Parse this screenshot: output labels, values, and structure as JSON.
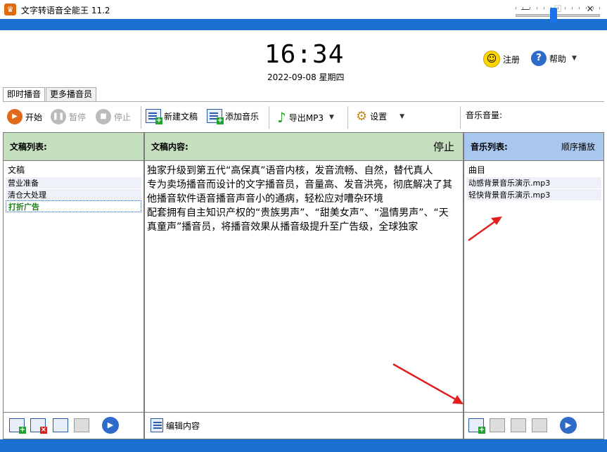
{
  "window": {
    "app_icon": "crown-icon",
    "title": "文字转语音全能王 11.2",
    "minimize": "—",
    "maximize": "☐",
    "close": "✕"
  },
  "header": {
    "clock": "16:34",
    "date": "2022-09-08 星期四",
    "register_label": "注册",
    "help_label": "帮助"
  },
  "tabs": [
    {
      "label": "即时播音"
    },
    {
      "label": "更多播音员"
    }
  ],
  "toolbar": {
    "start": "开始",
    "pause": "暂停",
    "stop": "停止",
    "new_doc": "新建文稿",
    "add_music": "添加音乐",
    "export_mp3": "导出MP3",
    "settings": "设置",
    "music_volume": "音乐音量:",
    "volume_level": 0.45
  },
  "doc_list": {
    "header": "文稿列表:",
    "column": "文稿",
    "items": [
      "营业准备",
      "清仓大处理",
      "打折广告"
    ],
    "selected_index": 2
  },
  "doc_content": {
    "header": "文稿内容:",
    "status": "停止",
    "text": "独家升级到第五代“高保真”语音内核，发音流畅、自然，替代真人\n专为卖场播音而设计的文字播音员，音量高、发音洪亮，彻底解决了其他播音软件语音播音声音小的通病，轻松应对嘈杂环境\n配套拥有自主知识产权的“贵族男声”、“甜美女声”、“温情男声”、“天真童声”播音员，将播音效果从播音级提升至广告级，全球独家",
    "edit_label": "编辑内容"
  },
  "music_list": {
    "header": "音乐列表:",
    "mode": "顺序播放",
    "column": "曲目",
    "items": [
      "动感背景音乐演示.mp3",
      "轻快背景音乐演示.mp3"
    ]
  },
  "colors": {
    "accent_blue": "#1b6fcf",
    "green_header": "#c6e0bf",
    "blue_header": "#a9c7ee",
    "arrow_red": "#e02020"
  }
}
